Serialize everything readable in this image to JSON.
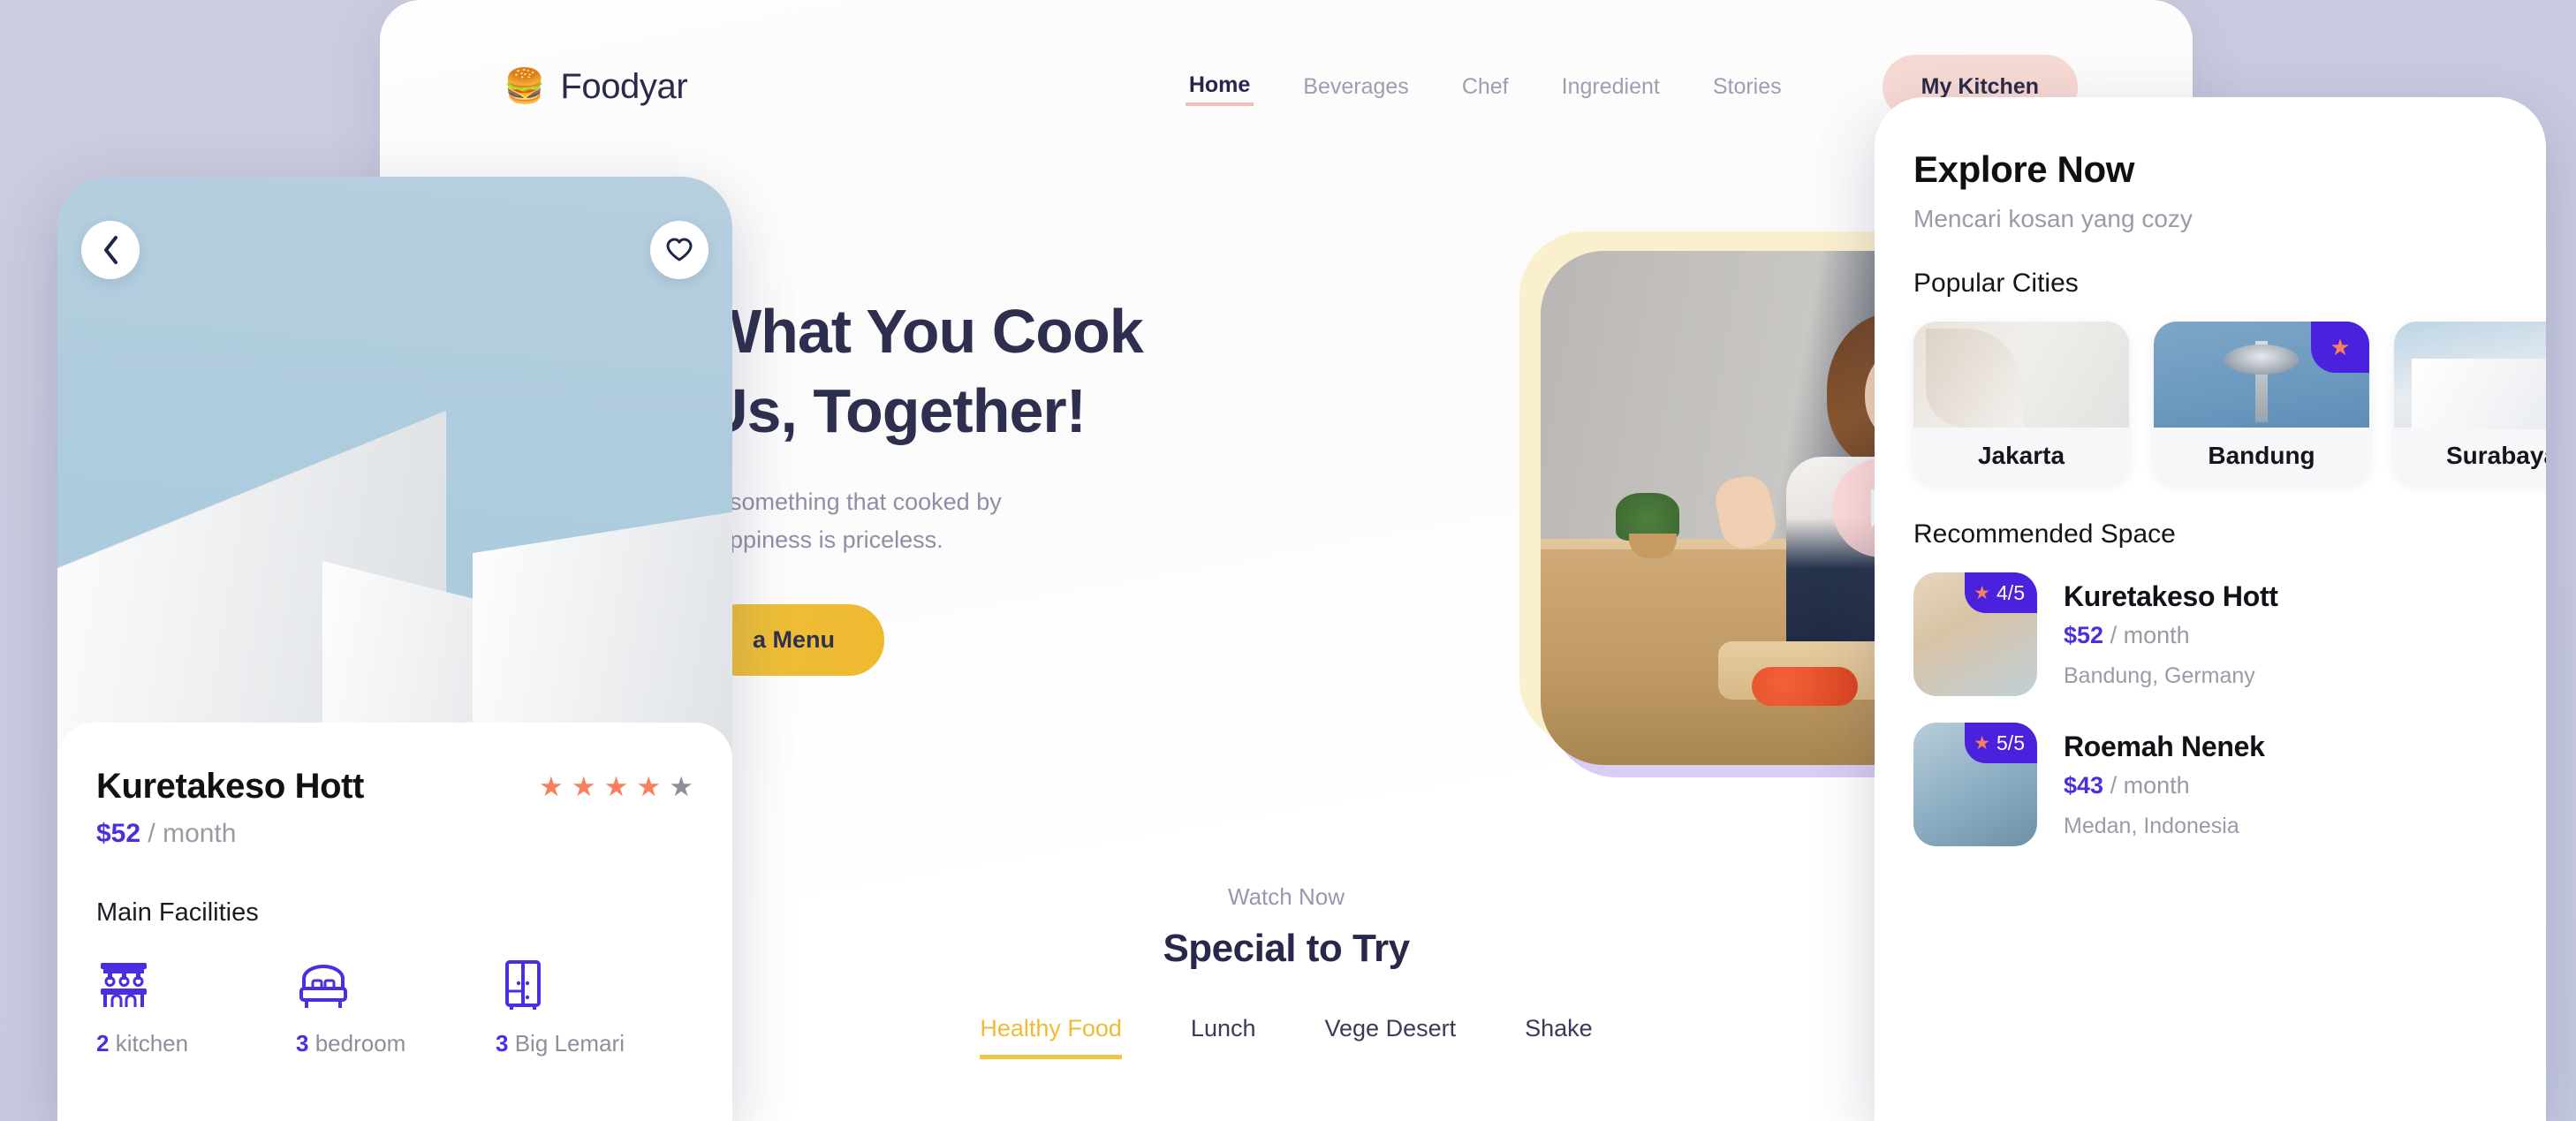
{
  "header": {
    "brand_mark": "hamburger-icon",
    "brand_mark_glyph": "🍔",
    "brand_name": "Foodyar",
    "nav": [
      {
        "label": "Home",
        "active": true
      },
      {
        "label": "Beverages",
        "active": false
      },
      {
        "label": "Chef",
        "active": false
      },
      {
        "label": "Ingredient",
        "active": false
      },
      {
        "label": "Stories",
        "active": false
      }
    ],
    "cta_label": "My Kitchen"
  },
  "hero": {
    "title_line1": "What You Cook",
    "title_line2_prefix": "Us, ",
    "title_line2_highlight": "Together!",
    "sub_line1": "at something that cooked by",
    "sub_line2": "happiness is priceless.",
    "cta_label": "a Menu",
    "play_icon": "play-icon"
  },
  "special": {
    "eyebrow": "Watch Now",
    "title": "Special to Try",
    "tabs": [
      {
        "label": "Healthy Food",
        "active": true
      },
      {
        "label": "Lunch",
        "active": false
      },
      {
        "label": "Vege Desert",
        "active": false
      },
      {
        "label": "Shake",
        "active": false
      }
    ]
  },
  "phone_left": {
    "back_icon": "chevron-left-icon",
    "favorite_icon": "heart-icon",
    "listing_title": "Kuretakeso Hott",
    "price_amount": "$52",
    "price_period": "/ month",
    "rating_filled": 4,
    "rating_total": 5,
    "facilities_title": "Main Facilities",
    "facilities": [
      {
        "icon": "kitchen-icon",
        "count": "2",
        "label": "kitchen"
      },
      {
        "icon": "bed-icon",
        "count": "3",
        "label": "bedroom"
      },
      {
        "icon": "wardrobe-icon",
        "count": "3",
        "label": "Big Lemari"
      }
    ]
  },
  "phone_right": {
    "title": "Explore Now",
    "subtitle": "Mencari kosan yang cozy",
    "popular_cities_title": "Popular Cities",
    "cities": [
      {
        "name": "Jakarta",
        "badge": false
      },
      {
        "name": "Bandung",
        "badge": true,
        "badge_icon": "star-icon"
      },
      {
        "name": "Surabaya",
        "badge": false
      }
    ],
    "recommended_title": "Recommended Space",
    "recommended": [
      {
        "name": "Kuretakeso Hott",
        "rating": "4/5",
        "price_amount": "$52",
        "price_period": "/ month",
        "location": "Bandung, Germany"
      },
      {
        "name": "Roemah Nenek",
        "rating": "5/5",
        "price_amount": "$43",
        "price_period": "/ month",
        "location": "Medan, Indonesia"
      }
    ]
  },
  "colors": {
    "page_background": "#ccccdf",
    "accent_yellow": "#efbb34",
    "accent_pink": "#f7d9d4",
    "accent_purple": "#4a21dd",
    "accent_coral": "#f9805f",
    "text_dark": "#28284a"
  }
}
